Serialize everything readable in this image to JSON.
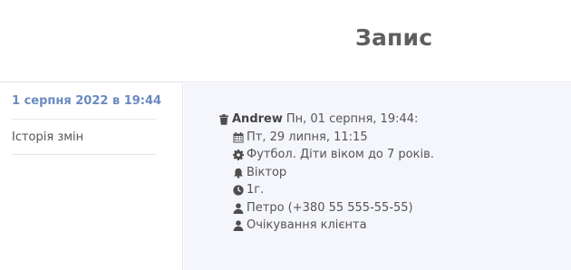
{
  "header": {
    "title": "Запис"
  },
  "sidebar": {
    "date": "1 серпня 2022 в 19:44",
    "history_link": "Історія змін"
  },
  "record": {
    "author": "Andrew",
    "changed_at": "Пн, 01 серпня, 19:44:",
    "fields": {
      "date": "Пт, 29 липня, 11:15",
      "service": "Футбол. Діти віком до 7 років.",
      "staff": "Віктор",
      "duration": "1г.",
      "client": "Петро (+380 55 555-55-55)",
      "status": "Очікування клієнта"
    }
  },
  "icons": {
    "delete": "trash-icon",
    "date": "calendar-icon",
    "service": "gear-icon",
    "staff": "bell-icon",
    "duration": "clock-icon",
    "client": "user-icon",
    "status": "user-icon"
  },
  "colors": {
    "date_link": "#6a8ac0",
    "content_bg": "#f5f6fb",
    "title": "#5f5f5f"
  }
}
